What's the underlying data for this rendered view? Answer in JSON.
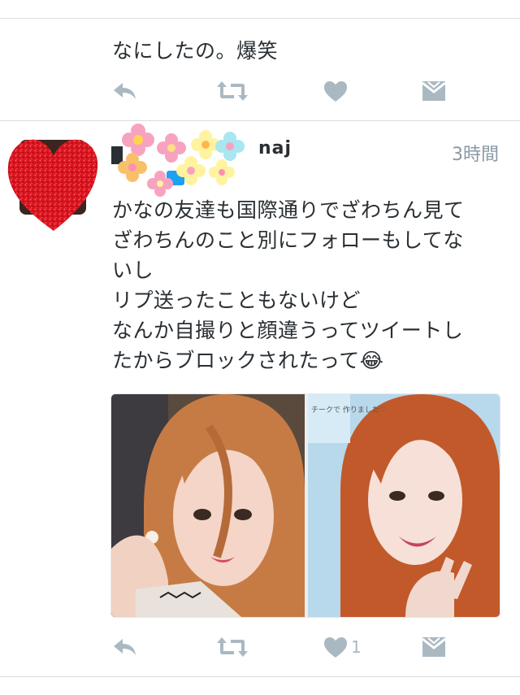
{
  "tweet1": {
    "text": "なにしたの。爆笑"
  },
  "tweet2": {
    "username_visible": "naj",
    "time": "3時間",
    "text_lines": [
      "かなの友達も国際通りでざわちん見て",
      "ざわちんのこと別にフォローもしてな",
      "いし",
      "リプ送ったこともないけど",
      "なんか自撮りと顔違うってツイートし",
      "たからブロックされたって😂"
    ],
    "like_count": "1",
    "photo_right_caption": "チークで 作りました♡"
  },
  "icons": [
    "reply-icon",
    "retweet-icon",
    "like-icon",
    "message-icon"
  ],
  "colors": {
    "icon": "#aab8c2",
    "separator": "#d8dde2",
    "text": "#292f33",
    "time": "#8899a6"
  }
}
